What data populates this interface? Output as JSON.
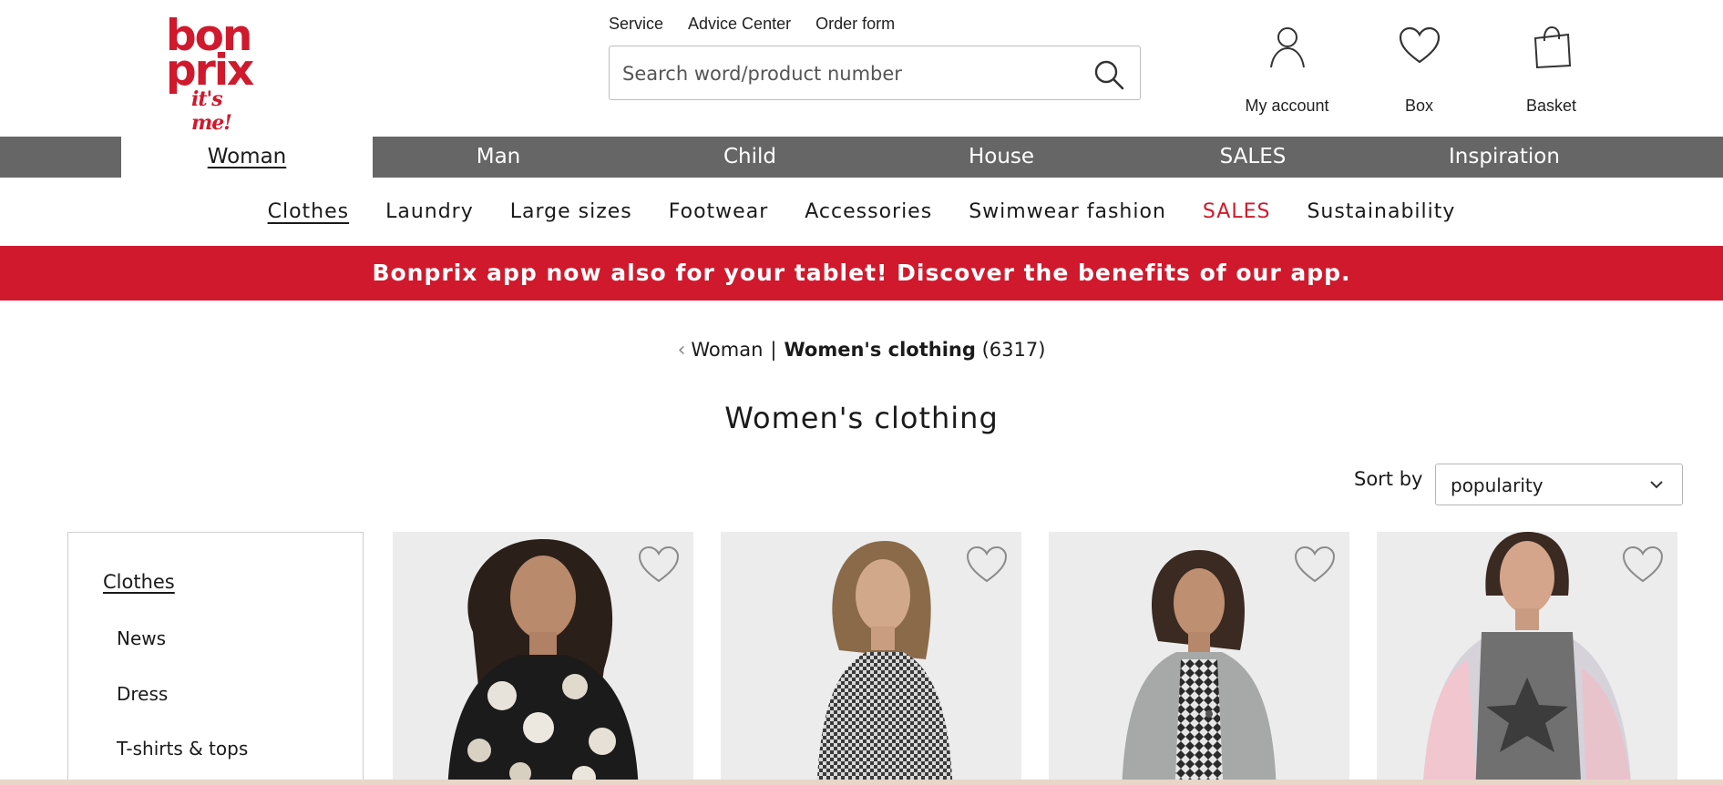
{
  "logo": {
    "line1": "bon",
    "line2": "prix",
    "tagline": "it's me!"
  },
  "service_links": [
    "Service",
    "Advice Center",
    "Order form"
  ],
  "search": {
    "placeholder": "Search word/product number",
    "value": ""
  },
  "header_actions": [
    {
      "label": "My account",
      "icon": "user-icon"
    },
    {
      "label": "Box",
      "icon": "heart-icon"
    },
    {
      "label": "Basket",
      "icon": "shopping-bag-icon"
    }
  ],
  "main_nav": {
    "tabs": [
      "Woman",
      "Man",
      "Child",
      "House",
      "SALES",
      "Inspiration"
    ],
    "active": "Woman"
  },
  "sub_nav": {
    "items": [
      "Clothes",
      "Laundry",
      "Large sizes",
      "Footwear",
      "Accessories",
      "Swimwear fashion",
      "SALES",
      "Sustainability"
    ],
    "active": "Clothes",
    "highlight": "SALES"
  },
  "banner": {
    "text": "Bonprix app now also for your tablet! Discover the benefits of our app."
  },
  "breadcrumb": {
    "parent": "Woman",
    "separator": "|",
    "current": "Women's clothing",
    "count": "(6317)"
  },
  "page_title": "Women's clothing",
  "sort": {
    "label": "Sort by",
    "selected": "popularity"
  },
  "sidebar": {
    "heading": "Clothes",
    "items": [
      "News",
      "Dress",
      "T-shirts & tops"
    ]
  },
  "products": [
    {
      "description": "woman in black floral print top",
      "icon": "heart-icon"
    },
    {
      "description": "woman in houndstooth dress",
      "icon": "heart-icon"
    },
    {
      "description": "woman in grey cardigan over patterned top",
      "icon": "heart-icon"
    },
    {
      "description": "woman in pastel colour-block hooded cardigan with star shirt",
      "icon": "heart-icon"
    }
  ],
  "colors": {
    "brand_red": "#d0192d",
    "nav_grey": "#666666",
    "text": "#1a1a1a"
  }
}
